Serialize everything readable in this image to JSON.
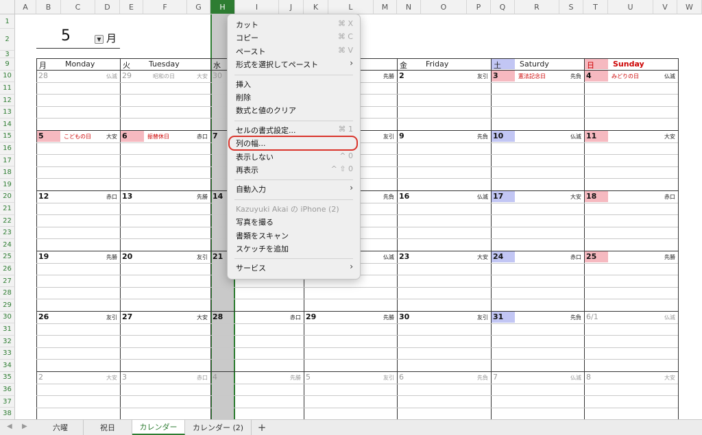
{
  "columns": [
    "A",
    "B",
    "C",
    "D",
    "E",
    "F",
    "G",
    "H",
    "I",
    "J",
    "K",
    "L",
    "M",
    "N",
    "O",
    "P",
    "Q",
    "R",
    "S",
    "T",
    "U",
    "V",
    "W"
  ],
  "selected_column": "H",
  "rows": [
    "1",
    "2",
    "3",
    "9",
    "10",
    "11",
    "12",
    "13",
    "14",
    "15",
    "16",
    "17",
    "18",
    "19",
    "20",
    "21",
    "22",
    "23",
    "24",
    "25",
    "26",
    "27",
    "28",
    "29",
    "30",
    "31",
    "32",
    "33",
    "34",
    "35",
    "36",
    "37",
    "38"
  ],
  "month": {
    "value": "5",
    "label": "月",
    "dropdown_icon": "dropdown-arrow-icon"
  },
  "day_headers": [
    {
      "jp": "月",
      "en": "Monday"
    },
    {
      "jp": "火",
      "en": "Tuesday"
    },
    {
      "jp": "水",
      "en": ""
    },
    {
      "jp": "",
      "en": "ay"
    },
    {
      "jp": "金",
      "en": "Friday"
    },
    {
      "jp": "土",
      "en": "Saturdy"
    },
    {
      "jp": "日",
      "en": "Sunday"
    }
  ],
  "weeks": [
    [
      {
        "day": "28",
        "rokuyo": "仏滅",
        "holiday": "",
        "gray": true
      },
      {
        "day": "29",
        "rokuyo": "大安",
        "holiday": "昭和の日",
        "gray": true
      },
      {
        "day": "30",
        "rokuyo": "",
        "holiday": "",
        "gray": true
      },
      {
        "day": "",
        "rokuyo": "先勝",
        "holiday": "",
        "gray": false
      },
      {
        "day": "2",
        "rokuyo": "友引",
        "holiday": "",
        "gray": false
      },
      {
        "day": "3",
        "rokuyo": "先負",
        "holiday": "憲法記念日",
        "gray": false,
        "shade": "pink"
      },
      {
        "day": "4",
        "rokuyo": "仏滅",
        "holiday": "みどりの日",
        "gray": false,
        "shade": "pink"
      }
    ],
    [
      {
        "day": "5",
        "rokuyo": "大安",
        "holiday": "こどもの日",
        "gray": false,
        "shade": "pink"
      },
      {
        "day": "6",
        "rokuyo": "赤口",
        "holiday": "振替休日",
        "gray": false,
        "shade": "pink"
      },
      {
        "day": "7",
        "rokuyo": "",
        "holiday": "",
        "gray": false
      },
      {
        "day": "",
        "rokuyo": "友引",
        "holiday": "",
        "gray": false
      },
      {
        "day": "9",
        "rokuyo": "先負",
        "holiday": "",
        "gray": false
      },
      {
        "day": "10",
        "rokuyo": "仏滅",
        "holiday": "",
        "gray": false,
        "shade": "blue"
      },
      {
        "day": "11",
        "rokuyo": "大安",
        "holiday": "",
        "gray": false,
        "shade": "pink"
      }
    ],
    [
      {
        "day": "12",
        "rokuyo": "赤口",
        "holiday": "",
        "gray": false
      },
      {
        "day": "13",
        "rokuyo": "先勝",
        "holiday": "",
        "gray": false
      },
      {
        "day": "14",
        "rokuyo": "",
        "holiday": "",
        "gray": false
      },
      {
        "day": "",
        "rokuyo": "先負",
        "holiday": "",
        "gray": false
      },
      {
        "day": "16",
        "rokuyo": "仏滅",
        "holiday": "",
        "gray": false
      },
      {
        "day": "17",
        "rokuyo": "大安",
        "holiday": "",
        "gray": false,
        "shade": "blue"
      },
      {
        "day": "18",
        "rokuyo": "赤口",
        "holiday": "",
        "gray": false,
        "shade": "pink"
      }
    ],
    [
      {
        "day": "19",
        "rokuyo": "先勝",
        "holiday": "",
        "gray": false
      },
      {
        "day": "20",
        "rokuyo": "友引",
        "holiday": "",
        "gray": false
      },
      {
        "day": "21",
        "rokuyo": "",
        "holiday": "",
        "gray": false
      },
      {
        "day": "",
        "rokuyo": "仏滅",
        "holiday": "",
        "gray": false
      },
      {
        "day": "23",
        "rokuyo": "大安",
        "holiday": "",
        "gray": false
      },
      {
        "day": "24",
        "rokuyo": "赤口",
        "holiday": "",
        "gray": false,
        "shade": "blue"
      },
      {
        "day": "25",
        "rokuyo": "先勝",
        "holiday": "",
        "gray": false,
        "shade": "pink"
      }
    ],
    [
      {
        "day": "26",
        "rokuyo": "友引",
        "holiday": "",
        "gray": false
      },
      {
        "day": "27",
        "rokuyo": "大安",
        "holiday": "",
        "gray": false
      },
      {
        "day": "28",
        "rokuyo": "赤口",
        "holiday": "",
        "gray": false
      },
      {
        "day": "29",
        "rokuyo": "先勝",
        "holiday": "",
        "gray": false
      },
      {
        "day": "30",
        "rokuyo": "友引",
        "holiday": "",
        "gray": false
      },
      {
        "day": "31",
        "rokuyo": "先負",
        "holiday": "",
        "gray": false,
        "shade": "blue"
      },
      {
        "day": "6/1",
        "rokuyo": "仏滅",
        "holiday": "",
        "gray": true
      }
    ],
    [
      {
        "day": "2",
        "rokuyo": "大安",
        "holiday": "",
        "gray": true
      },
      {
        "day": "3",
        "rokuyo": "赤口",
        "holiday": "",
        "gray": true
      },
      {
        "day": "4",
        "rokuyo": "先勝",
        "holiday": "",
        "gray": true
      },
      {
        "day": "5",
        "rokuyo": "友引",
        "holiday": "",
        "gray": true
      },
      {
        "day": "6",
        "rokuyo": "先負",
        "holiday": "",
        "gray": true
      },
      {
        "day": "7",
        "rokuyo": "仏滅",
        "holiday": "",
        "gray": true
      },
      {
        "day": "8",
        "rokuyo": "大安",
        "holiday": "",
        "gray": true
      }
    ]
  ],
  "context_menu": [
    {
      "type": "item",
      "label": "カット",
      "shortcut": "⌘ X"
    },
    {
      "type": "item",
      "label": "コピー",
      "shortcut": "⌘ C"
    },
    {
      "type": "item",
      "label": "ペースト",
      "shortcut": "⌘ V"
    },
    {
      "type": "item",
      "label": "形式を選択してペースト",
      "submenu": true
    },
    {
      "type": "sep"
    },
    {
      "type": "item",
      "label": "挿入"
    },
    {
      "type": "item",
      "label": "削除"
    },
    {
      "type": "item",
      "label": "数式と値のクリア"
    },
    {
      "type": "sep"
    },
    {
      "type": "item",
      "label": "セルの書式設定...",
      "shortcut": "⌘ 1"
    },
    {
      "type": "item",
      "label": "列の幅...",
      "highlighted": true
    },
    {
      "type": "item",
      "label": "表示しない",
      "shortcut": "^ 0"
    },
    {
      "type": "item",
      "label": "再表示",
      "shortcut": "^ ⇧ 0"
    },
    {
      "type": "sep"
    },
    {
      "type": "item",
      "label": "自動入力",
      "submenu": true
    },
    {
      "type": "sep"
    },
    {
      "type": "item",
      "label": "Kazuyuki Akai の iPhone (2)",
      "disabled": true
    },
    {
      "type": "item",
      "label": "写真を撮る"
    },
    {
      "type": "item",
      "label": "書類をスキャン"
    },
    {
      "type": "item",
      "label": "スケッチを追加"
    },
    {
      "type": "sep"
    },
    {
      "type": "item",
      "label": "サービス",
      "submenu": true
    }
  ],
  "sheet_tabs": [
    {
      "label": "六曜",
      "active": false
    },
    {
      "label": "祝日",
      "active": false
    },
    {
      "label": "カレンダー",
      "active": true
    },
    {
      "label": "カレンダー (2)",
      "active": false
    }
  ],
  "add_tab_label": "+",
  "nav_icons": [
    "prev-sheet-icon",
    "next-sheet-icon"
  ],
  "colors": {
    "accent": "#2e7d32",
    "holiday_red": "#cc0000",
    "pink_shade": "#f6b9c0",
    "blue_shade": "#c2c6f4",
    "highlight": "#d9332a"
  }
}
